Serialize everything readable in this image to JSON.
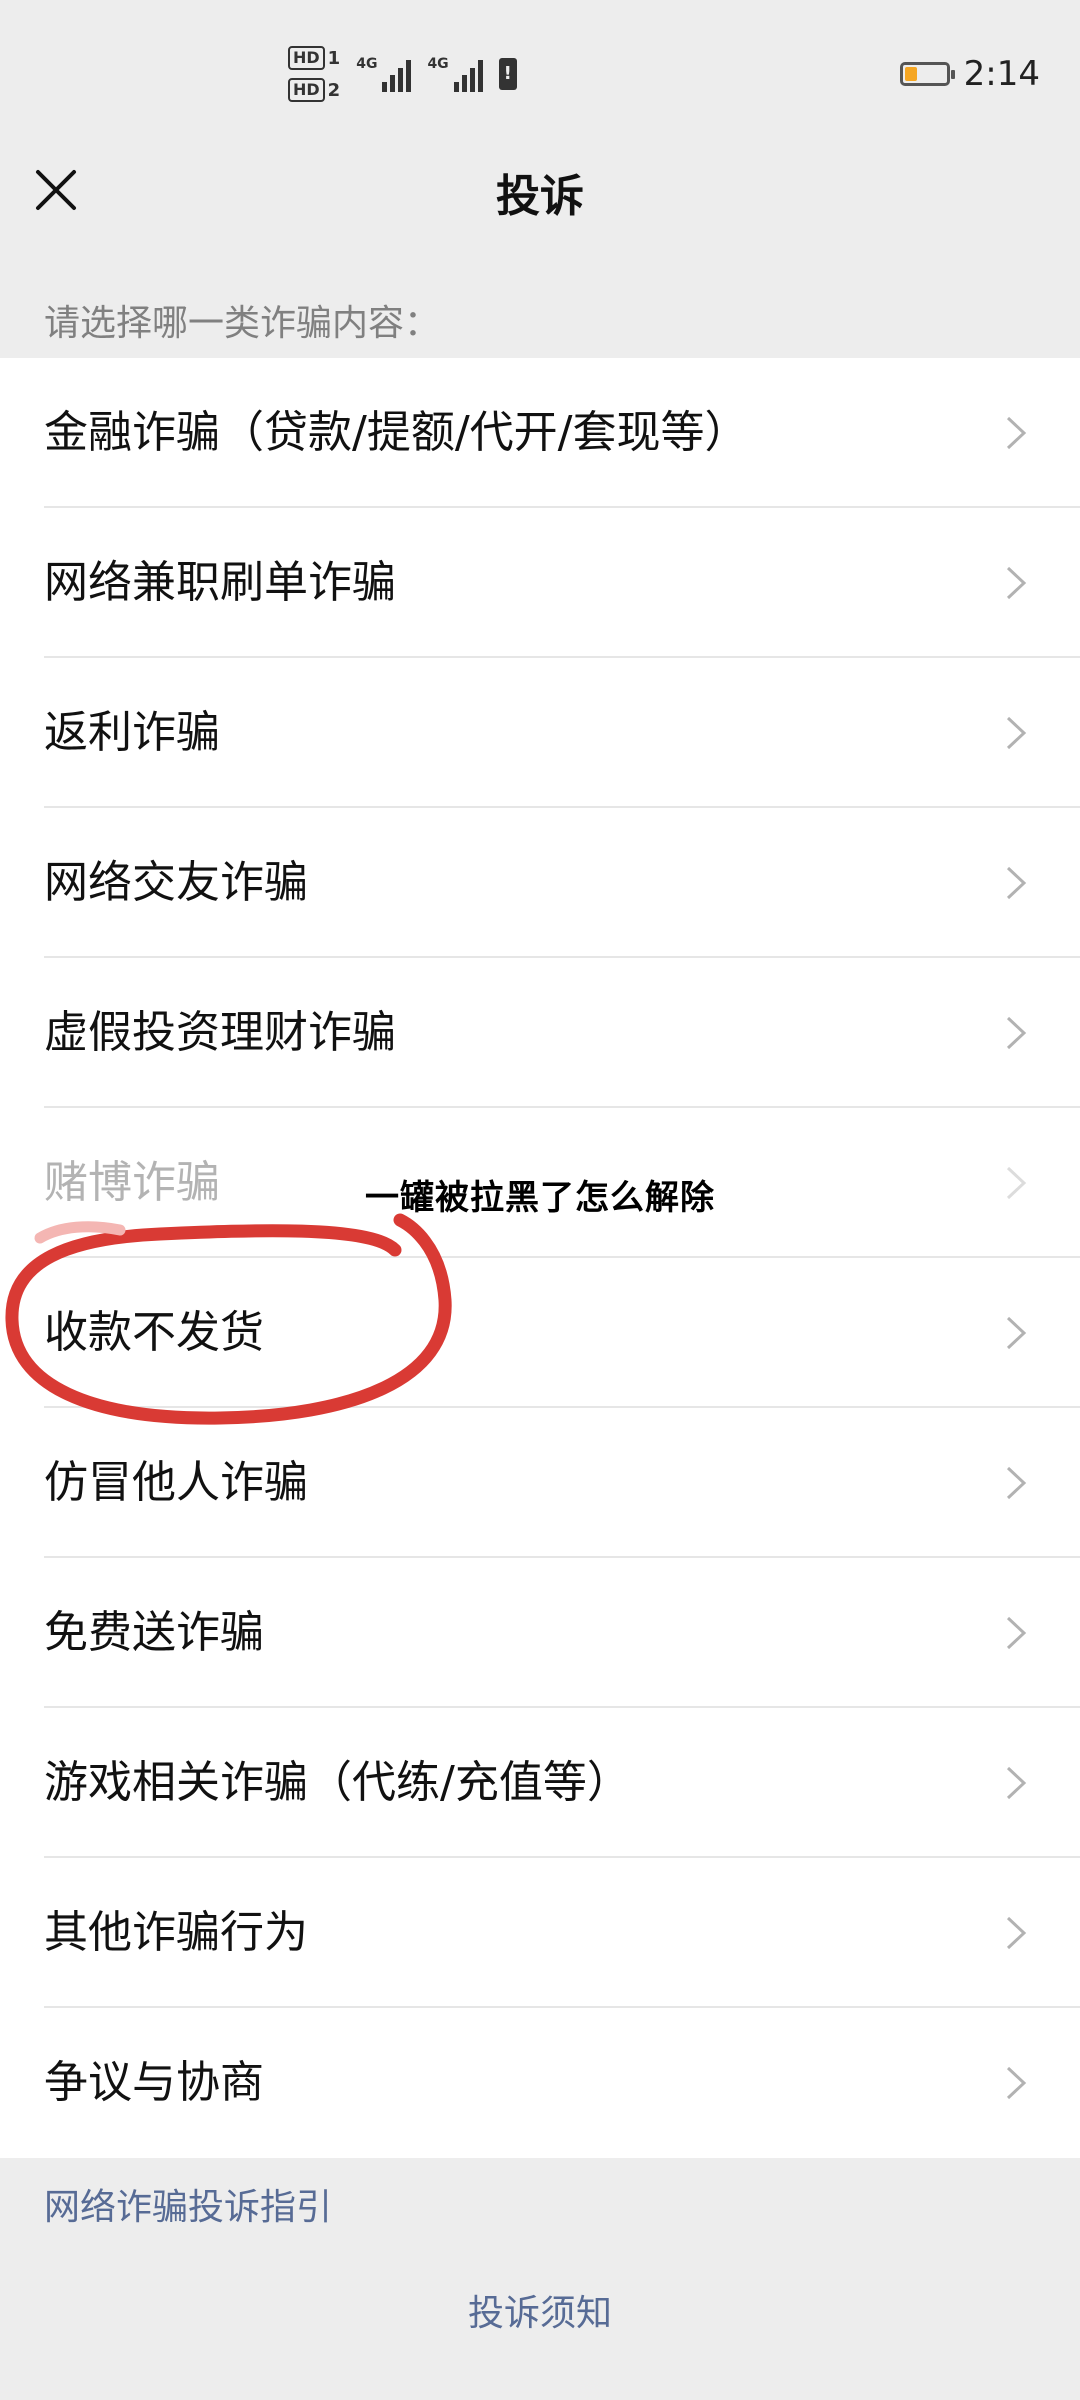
{
  "status_bar": {
    "hd1": "HD",
    "hd1_sub": "1",
    "hd2": "HD",
    "hd2_sub": "2",
    "network1": "4G",
    "network2": "4G",
    "battery_warning": "!",
    "time": "2:14",
    "battery_level_fraction": 0.15,
    "battery_color": "#f5a623"
  },
  "nav": {
    "close_icon": "close-icon",
    "title": "投诉"
  },
  "section_label": "请选择哪一类诈骗内容：",
  "list": {
    "items": [
      {
        "label": "金融诈骗（贷款/提额/代开/套现等）"
      },
      {
        "label": "网络兼职刷单诈骗"
      },
      {
        "label": "返利诈骗"
      },
      {
        "label": "网络交友诈骗"
      },
      {
        "label": "虚假投资理财诈骗"
      },
      {
        "label": "赌博诈骗"
      },
      {
        "label": "收款不发货"
      },
      {
        "label": "仿冒他人诈骗"
      },
      {
        "label": "免费送诈骗"
      },
      {
        "label": "游戏相关诈骗（代练/充值等）"
      },
      {
        "label": "其他诈骗行为"
      },
      {
        "label": "争议与协商"
      }
    ],
    "chevron_icon": "chevron-right-icon"
  },
  "overlay_caption": "一罐被拉黑了怎么解除",
  "annotation_color": "#d93a34",
  "footer": {
    "guide_link": "网络诈骗投诉指引",
    "notice_link": "投诉须知",
    "link_color": "#576b95"
  }
}
